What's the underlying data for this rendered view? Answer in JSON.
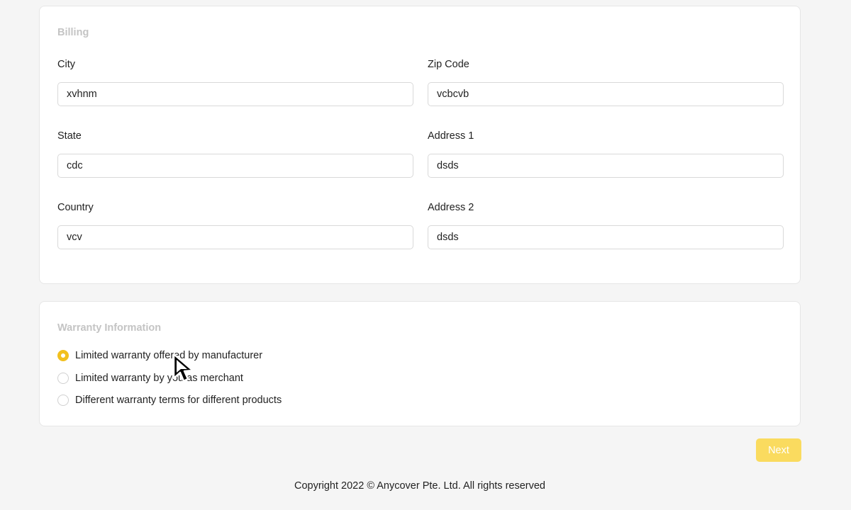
{
  "billing": {
    "title": "Billing",
    "fields": {
      "city": {
        "label": "City",
        "value": "xvhnm"
      },
      "zip": {
        "label": "Zip Code",
        "value": "vcbcvb"
      },
      "state": {
        "label": "State",
        "value": "cdc"
      },
      "address1": {
        "label": "Address 1",
        "value": "dsds"
      },
      "country": {
        "label": "Country",
        "value": "vcv"
      },
      "address2": {
        "label": "Address 2",
        "value": "dsds"
      }
    }
  },
  "warranty": {
    "title": "Warranty Information",
    "options": [
      {
        "label": "Limited warranty offered by manufacturer",
        "selected": true
      },
      {
        "label": "Limited warranty by you as merchant",
        "selected": false
      },
      {
        "label": "Different warranty terms for different products",
        "selected": false
      }
    ]
  },
  "actions": {
    "next_label": "Next"
  },
  "footer": {
    "copyright": "Copyright 2022 © Anycover Pte. Ltd. All rights reserved"
  },
  "colors": {
    "accent": "#f2c01e",
    "button": "#fadb5f",
    "section_title": "#c4c4c4",
    "background": "#f5f5f5"
  },
  "icons": {
    "cursor": "mouse-pointer-icon"
  }
}
